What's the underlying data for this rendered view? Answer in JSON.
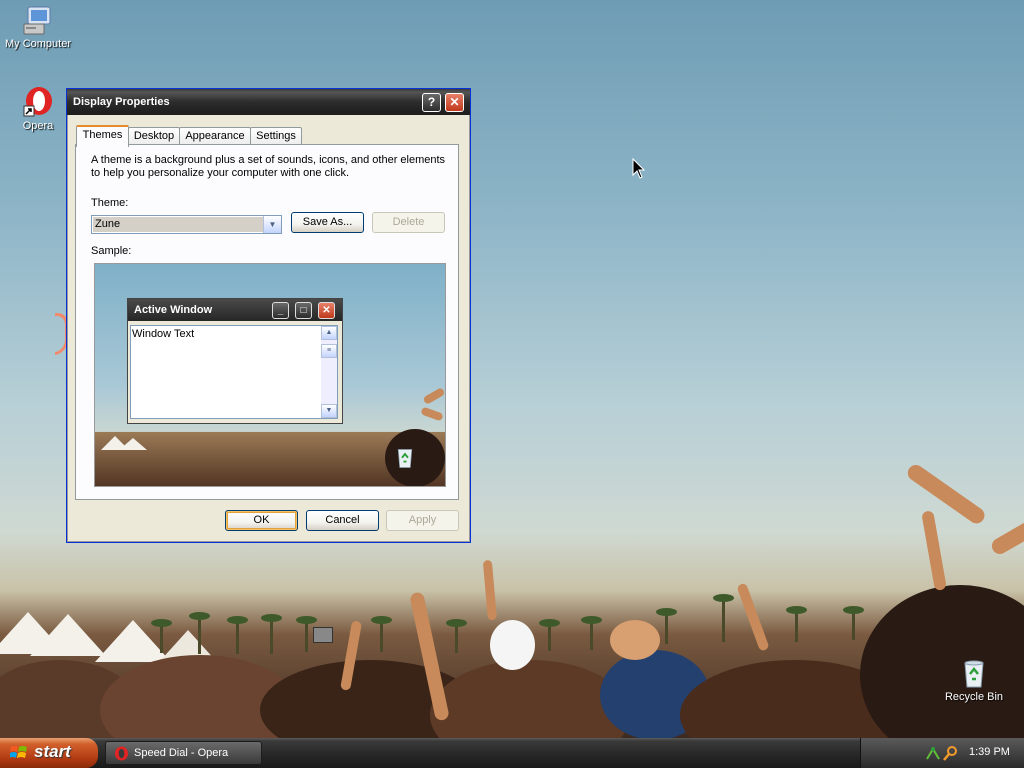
{
  "desktop": {
    "icons": [
      {
        "label": "My Computer"
      },
      {
        "label": "Opera"
      },
      {
        "label": "Recycle Bin"
      }
    ]
  },
  "dialog": {
    "title": "Display Properties",
    "help_glyph": "?",
    "close_glyph": "✕",
    "tabs": [
      {
        "label": "Themes",
        "selected": true
      },
      {
        "label": "Desktop"
      },
      {
        "label": "Appearance"
      },
      {
        "label": "Settings"
      }
    ],
    "description": "A theme is a background plus a set of sounds, icons, and other elements to help you personalize your computer with one click.",
    "theme_label": "Theme:",
    "theme_value": "Zune",
    "save_as_label": "Save As...",
    "delete_label": "Delete",
    "sample_label": "Sample:",
    "sample": {
      "window_title": "Active Window",
      "window_text": "Window Text"
    },
    "ok_label": "OK",
    "cancel_label": "Cancel",
    "apply_label": "Apply"
  },
  "taskbar": {
    "start_label": "start",
    "task_label": "Speed Dial - Opera",
    "clock": "1:39 PM"
  },
  "colors": {
    "title_bar": "#2c2c2c",
    "start_button": "#d2602c",
    "selected_tab_accent": "#e68b2c"
  }
}
